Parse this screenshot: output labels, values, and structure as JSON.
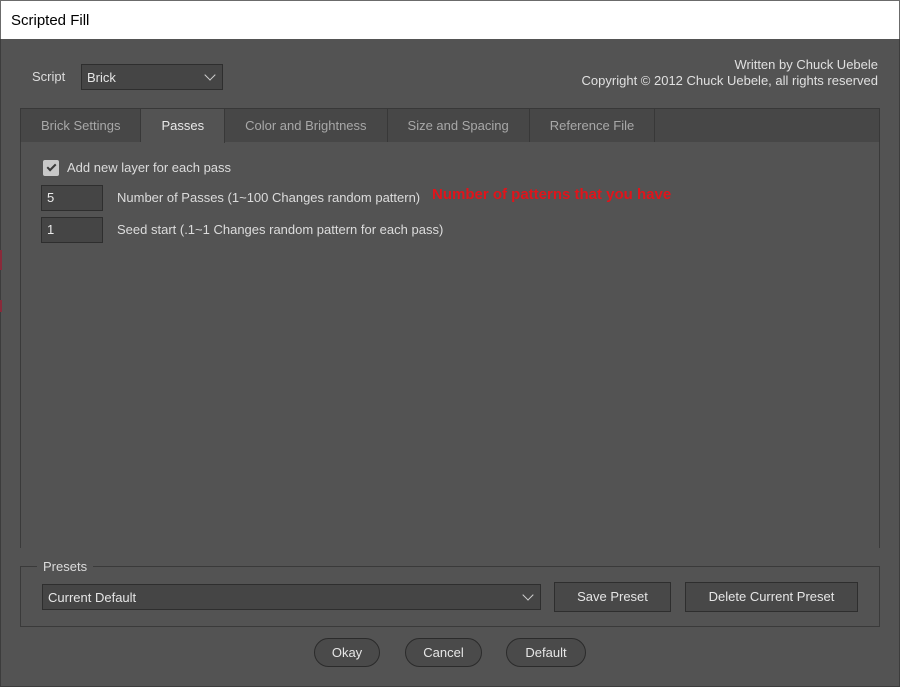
{
  "window": {
    "title": "Scripted Fill"
  },
  "script": {
    "label": "Script",
    "selected": "Brick"
  },
  "credits": {
    "line1": "Written by Chuck Uebele",
    "line2": "Copyright © 2012 Chuck Uebele, all rights reserved"
  },
  "tabs": [
    {
      "label": "Brick Settings",
      "active": false
    },
    {
      "label": "Passes",
      "active": true
    },
    {
      "label": "Color and Brightness",
      "active": false
    },
    {
      "label": "Size and Spacing",
      "active": false
    },
    {
      "label": "Reference File",
      "active": false
    }
  ],
  "passes": {
    "add_layer_label": "Add new layer for each pass",
    "add_layer_checked": true,
    "num_passes_value": "5",
    "num_passes_label": "Number of Passes (1~100 Changes random pattern)",
    "seed_value": "1",
    "seed_label": "Seed start (.1~1 Changes random pattern for each pass)",
    "annotation": "Number of patterns that you have",
    "annotation_color": "#e0141b"
  },
  "presets": {
    "legend": "Presets",
    "selected": "Current Default",
    "save_label": "Save Preset",
    "delete_label": "Delete Current Preset"
  },
  "footer": {
    "okay_label": "Okay",
    "cancel_label": "Cancel",
    "default_label": "Default"
  }
}
